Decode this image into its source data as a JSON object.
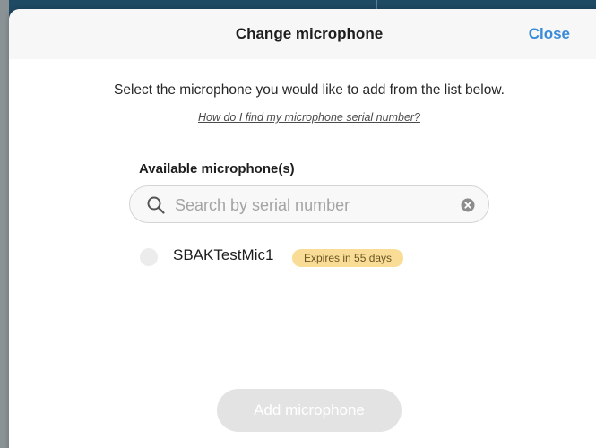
{
  "modal": {
    "title": "Change microphone",
    "close_label": "Close",
    "instructions": "Select the microphone you would like to add from the list below.",
    "help_link": "How do I find my microphone serial number?",
    "section_heading": "Available microphone(s)"
  },
  "search": {
    "placeholder": "Search by serial number",
    "value": "",
    "icon": "search-icon",
    "clear_icon": "clear-icon"
  },
  "microphones": [
    {
      "name": "SBAKTestMic1",
      "badge": "Expires in 55 days",
      "selected": false
    }
  ],
  "actions": {
    "add_label": "Add microphone",
    "add_enabled": false
  },
  "colors": {
    "accent": "#3a8bd8",
    "badge_bg": "#f9dc95",
    "disabled_button": "#e3e3e3",
    "header_bg": "#f7f7f7",
    "app_bar": "#1f4a63"
  }
}
